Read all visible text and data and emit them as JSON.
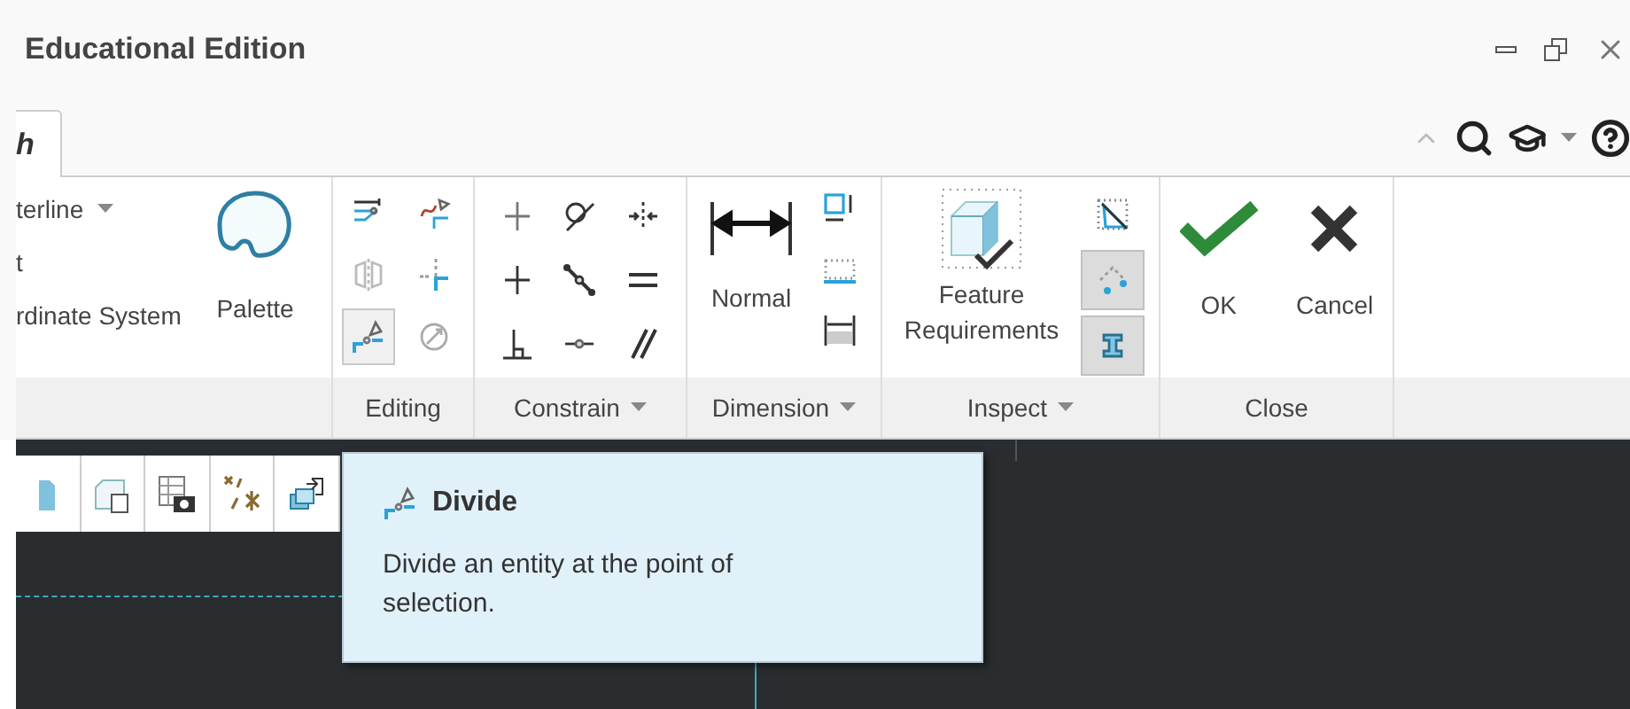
{
  "window": {
    "title": "Educational Edition"
  },
  "tabs": [
    {
      "label": "h",
      "selected": true
    }
  ],
  "ribbon": {
    "sketch_items": [
      {
        "label": "terline",
        "has_menu": true
      },
      {
        "label": "t",
        "has_menu": false
      },
      {
        "label": "rdinate System",
        "has_menu": false
      }
    ],
    "palette": {
      "label": "Palette"
    },
    "editing_tools": [
      {
        "kind": "trim",
        "selected": false
      },
      {
        "kind": "corner",
        "selected": false
      },
      {
        "kind": "mirror",
        "selected": false
      },
      {
        "kind": "split",
        "selected": false
      },
      {
        "kind": "divide",
        "selected": true
      },
      {
        "kind": "rotate",
        "selected": false
      }
    ],
    "constrain_tools": [
      {
        "kind": "vertical"
      },
      {
        "kind": "tangent"
      },
      {
        "kind": "midpoint"
      },
      {
        "kind": "horizontal"
      },
      {
        "kind": "coincident"
      },
      {
        "kind": "equal"
      },
      {
        "kind": "perpendicular"
      },
      {
        "kind": "point"
      },
      {
        "kind": "parallel"
      }
    ],
    "dimension": {
      "label": "Normal"
    },
    "dimension_tools": [
      {
        "kind": "baseline"
      },
      {
        "kind": "perimeter"
      },
      {
        "kind": "reference"
      }
    ],
    "inspect": {
      "label": "Feature Requirements"
    },
    "inspect_tools": [
      {
        "kind": "overlap",
        "selected": false
      },
      {
        "kind": "highlight",
        "selected": true
      },
      {
        "kind": "shade",
        "selected": true
      }
    ],
    "close_buttons": [
      {
        "kind": "ok",
        "label": "OK"
      },
      {
        "kind": "cancel",
        "label": "Cancel"
      }
    ],
    "groups": [
      {
        "label": "Editing",
        "has_menu": false
      },
      {
        "label": "Constrain",
        "has_menu": true
      },
      {
        "label": "Dimension",
        "has_menu": true
      },
      {
        "label": "Inspect",
        "has_menu": true
      },
      {
        "label": "Close",
        "has_menu": false
      }
    ]
  },
  "tooltip": {
    "title": "Divide",
    "text": "Divide an entity at the point of selection."
  }
}
